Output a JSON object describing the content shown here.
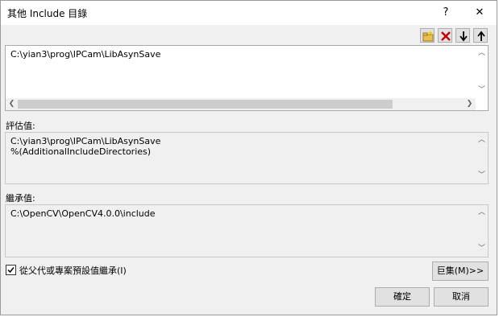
{
  "window": {
    "title": "其他 Include 目錄",
    "help_label": "?",
    "close_label": "✕"
  },
  "toolbar": {
    "new_line_icon": "new-folder-icon",
    "delete_icon": "delete-icon",
    "move_down_icon": "arrow-down-icon",
    "move_up_icon": "arrow-up-icon",
    "delete_color": "#c00000"
  },
  "editor": {
    "lines": [
      "C:\\yian3\\prog\\IPCam\\LibAsynSave"
    ]
  },
  "evaluated": {
    "label": "評估值:",
    "lines": [
      "C:\\yian3\\prog\\IPCam\\LibAsynSave",
      "%(AdditionalIncludeDirectories)"
    ]
  },
  "inherited": {
    "label": "繼承值:",
    "lines": [
      "C:\\OpenCV\\OpenCV4.0.0\\include"
    ]
  },
  "inherit_checkbox": {
    "label": "從父代或專案預設值繼承(I)",
    "checked": true
  },
  "buttons": {
    "macros": "巨集(M)>>",
    "ok": "確定",
    "cancel": "取消"
  }
}
